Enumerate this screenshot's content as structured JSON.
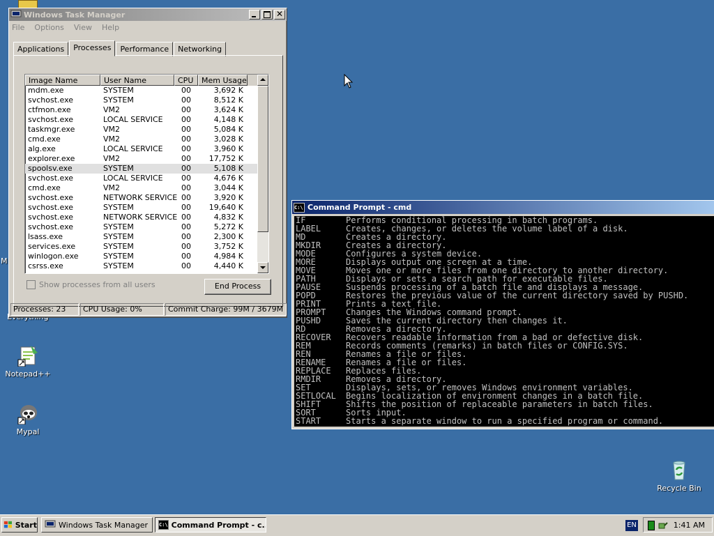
{
  "desktop": {
    "icons": [
      {
        "label": "Notepad++"
      },
      {
        "label": "Mypal"
      },
      {
        "label": "Recycle Bin"
      }
    ],
    "partial_labels": {
      "left_clip": "M",
      "everything": "Everything"
    }
  },
  "taskmgr": {
    "title": "Windows Task Manager",
    "menu": [
      "File",
      "Options",
      "View",
      "Help"
    ],
    "tabs": [
      "Applications",
      "Processes",
      "Performance",
      "Networking"
    ],
    "selected_tab": "Processes",
    "columns": [
      "Image Name",
      "User Name",
      "CPU",
      "Mem Usage"
    ],
    "rows": [
      [
        "mdm.exe",
        "SYSTEM",
        "00",
        "3,692 K"
      ],
      [
        "svchost.exe",
        "SYSTEM",
        "00",
        "8,512 K"
      ],
      [
        "ctfmon.exe",
        "VM2",
        "00",
        "3,624 K"
      ],
      [
        "svchost.exe",
        "LOCAL SERVICE",
        "00",
        "4,148 K"
      ],
      [
        "taskmgr.exe",
        "VM2",
        "00",
        "5,084 K"
      ],
      [
        "cmd.exe",
        "VM2",
        "00",
        "3,028 K"
      ],
      [
        "alg.exe",
        "LOCAL SERVICE",
        "00",
        "3,960 K"
      ],
      [
        "explorer.exe",
        "VM2",
        "00",
        "17,752 K"
      ],
      [
        "spoolsv.exe",
        "SYSTEM",
        "00",
        "5,108 K"
      ],
      [
        "svchost.exe",
        "LOCAL SERVICE",
        "00",
        "4,676 K"
      ],
      [
        "cmd.exe",
        "VM2",
        "00",
        "3,044 K"
      ],
      [
        "svchost.exe",
        "NETWORK SERVICE",
        "00",
        "3,920 K"
      ],
      [
        "svchost.exe",
        "SYSTEM",
        "00",
        "19,640 K"
      ],
      [
        "svchost.exe",
        "NETWORK SERVICE",
        "00",
        "4,832 K"
      ],
      [
        "svchost.exe",
        "SYSTEM",
        "00",
        "5,272 K"
      ],
      [
        "lsass.exe",
        "SYSTEM",
        "00",
        "2,300 K"
      ],
      [
        "services.exe",
        "SYSTEM",
        "00",
        "3,752 K"
      ],
      [
        "winlogon.exe",
        "SYSTEM",
        "00",
        "4,984 K"
      ],
      [
        "csrss.exe",
        "SYSTEM",
        "00",
        "4,440 K"
      ]
    ],
    "highlighted_row": 8,
    "show_all_label": "Show processes from all users",
    "end_process_label": "End Process",
    "status": {
      "processes": "Processes: 23",
      "cpu": "CPU Usage: 0%",
      "commit": "Commit Charge: 99M / 3679M"
    }
  },
  "cmd": {
    "title": "Command Prompt - cmd",
    "lines": [
      [
        "IF",
        "Performs conditional processing in batch programs."
      ],
      [
        "LABEL",
        "Creates, changes, or deletes the volume label of a disk."
      ],
      [
        "MD",
        "Creates a directory."
      ],
      [
        "MKDIR",
        "Creates a directory."
      ],
      [
        "MODE",
        "Configures a system device."
      ],
      [
        "MORE",
        "Displays output one screen at a time."
      ],
      [
        "MOVE",
        "Moves one or more files from one directory to another directory."
      ],
      [
        "PATH",
        "Displays or sets a search path for executable files."
      ],
      [
        "PAUSE",
        "Suspends processing of a batch file and displays a message."
      ],
      [
        "POPD",
        "Restores the previous value of the current directory saved by PUSHD."
      ],
      [
        "PRINT",
        "Prints a text file."
      ],
      [
        "PROMPT",
        "Changes the Windows command prompt."
      ],
      [
        "PUSHD",
        "Saves the current directory then changes it."
      ],
      [
        "RD",
        "Removes a directory."
      ],
      [
        "RECOVER",
        "Recovers readable information from a bad or defective disk."
      ],
      [
        "REM",
        "Records comments (remarks) in batch files or CONFIG.SYS."
      ],
      [
        "REN",
        "Renames a file or files."
      ],
      [
        "RENAME",
        "Renames a file or files."
      ],
      [
        "REPLACE",
        "Replaces files."
      ],
      [
        "RMDIR",
        "Removes a directory."
      ],
      [
        "SET",
        "Displays, sets, or removes Windows environment variables."
      ],
      [
        "SETLOCAL",
        "Begins localization of environment changes in a batch file."
      ],
      [
        "SHIFT",
        "Shifts the position of replaceable parameters in batch files."
      ],
      [
        "SORT",
        "Sorts input."
      ],
      [
        "START",
        "Starts a separate window to run a specified program or command."
      ]
    ]
  },
  "taskbar": {
    "start_label": "Start",
    "tasks": [
      {
        "label": "Windows Task Manager",
        "active": false
      },
      {
        "label": "Command Prompt - c...",
        "active": true
      }
    ],
    "lang": "EN",
    "clock": "1:41 AM"
  },
  "colors": {
    "desktop": "#3a6ea5",
    "titlebar_active": "#0a246a"
  }
}
